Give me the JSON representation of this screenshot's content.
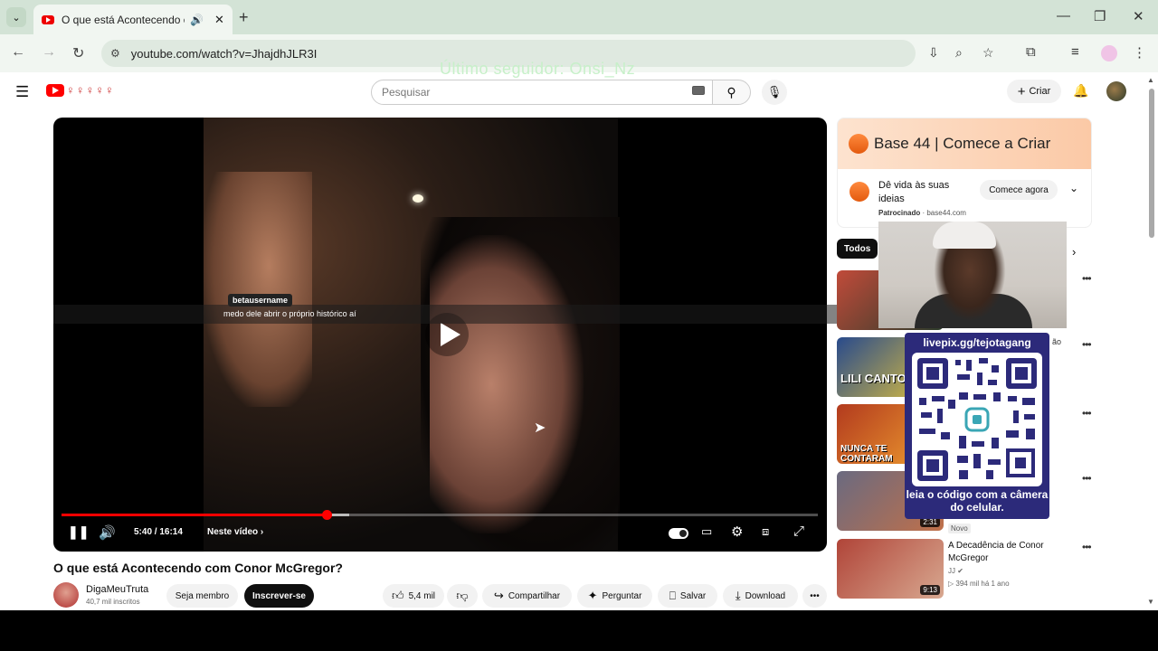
{
  "browser": {
    "tab_title": "O que está Acontecendo co",
    "tab_audio_icon": "speaker-icon",
    "url": "youtube.com/watch?v=JhajdhJLR3I",
    "overlay_text": "Último seguidor: Onsi_Nz"
  },
  "youtube": {
    "search_placeholder": "Pesquisar",
    "create_label": "Criar"
  },
  "player": {
    "chat_user": "betausername",
    "chat_message": "medo dele abrir o próprio histórico aí",
    "time": "5:40 / 16:14",
    "chapter_label": "Neste vídeo",
    "progress": 0.35
  },
  "video": {
    "title": "O que está Acontecendo com Conor McGregor?",
    "channel": "DigaMeuTruta",
    "subscribers": "40,7 mil inscritos",
    "member_label": "Seja membro",
    "subscribe_label": "Inscrever-se",
    "likes": "5,4 mil",
    "share_label": "Compartilhar",
    "ask_label": "Perguntar",
    "save_label": "Salvar",
    "download_label": "Download"
  },
  "ad": {
    "brand": "Base 44 | Comece a Criar",
    "description": "Dê vida às suas ideias",
    "sponsored": "Patrocinado",
    "domain": "base44.com",
    "cta": "Comece agora"
  },
  "sidebar": {
    "chip_all": "Todos",
    "thumb2_text": "LILI CANTOU",
    "thumb3_text": "NUNCA TE CONTARAM",
    "thumb4_duration": "2:31",
    "badge_new": "Novo",
    "rec5_title": "A Decadência de Conor McGregor",
    "rec5_channel": "JJ",
    "rec5_meta": "394 mil  há 1 ano",
    "rec5_duration": "9:13",
    "rec2_fragment": "ão"
  },
  "qr": {
    "url": "livepix.gg/tejotagang",
    "caption": "leia o código com a câmera do celular."
  }
}
